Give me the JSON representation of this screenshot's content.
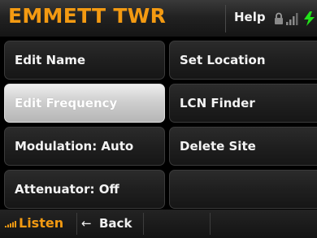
{
  "app": {
    "title": "EMMETT TWR",
    "accent_color": "#f39a12"
  },
  "titlebar": {
    "help_label": "Help",
    "icons": [
      "lock-icon",
      "signal-icon",
      "power-icon"
    ]
  },
  "menu": {
    "items": [
      {
        "label": "Edit Name",
        "selected": false
      },
      {
        "label": "Set Location",
        "selected": false
      },
      {
        "label": "Edit Frequency",
        "selected": true
      },
      {
        "label": "LCN Finder",
        "selected": false
      },
      {
        "label": "Modulation: Auto",
        "selected": false
      },
      {
        "label": "Delete Site",
        "selected": false
      },
      {
        "label": "Attenuator: Off",
        "selected": false
      },
      {
        "label": "",
        "selected": false
      }
    ]
  },
  "bottombar": {
    "listen_label": "Listen",
    "back_arrow": "←",
    "back_label": "Back"
  }
}
